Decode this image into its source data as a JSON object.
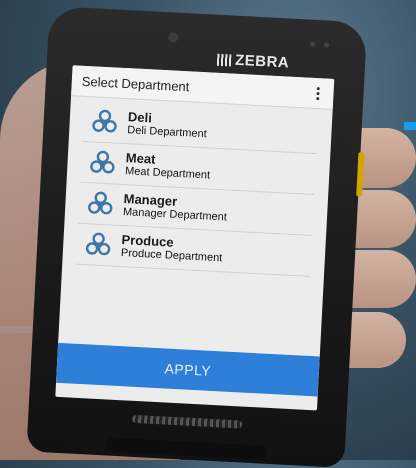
{
  "device": {
    "brand_label": "ZEBRA"
  },
  "app": {
    "title": "Select Department",
    "menu_icon": "kebab-menu-icon"
  },
  "departments": [
    {
      "name": "Deli",
      "description": "Deli Department",
      "icon": "department-icon"
    },
    {
      "name": "Meat",
      "description": "Meat Department",
      "icon": "department-icon"
    },
    {
      "name": "Manager",
      "description": "Manager Department",
      "icon": "department-icon"
    },
    {
      "name": "Produce",
      "description": "Produce Department",
      "icon": "department-icon"
    }
  ],
  "actions": {
    "apply_label": "APPLY"
  },
  "colors": {
    "accent": "#1a9bf0",
    "button": "#2e7fd8",
    "icon": "#3f76a8"
  }
}
